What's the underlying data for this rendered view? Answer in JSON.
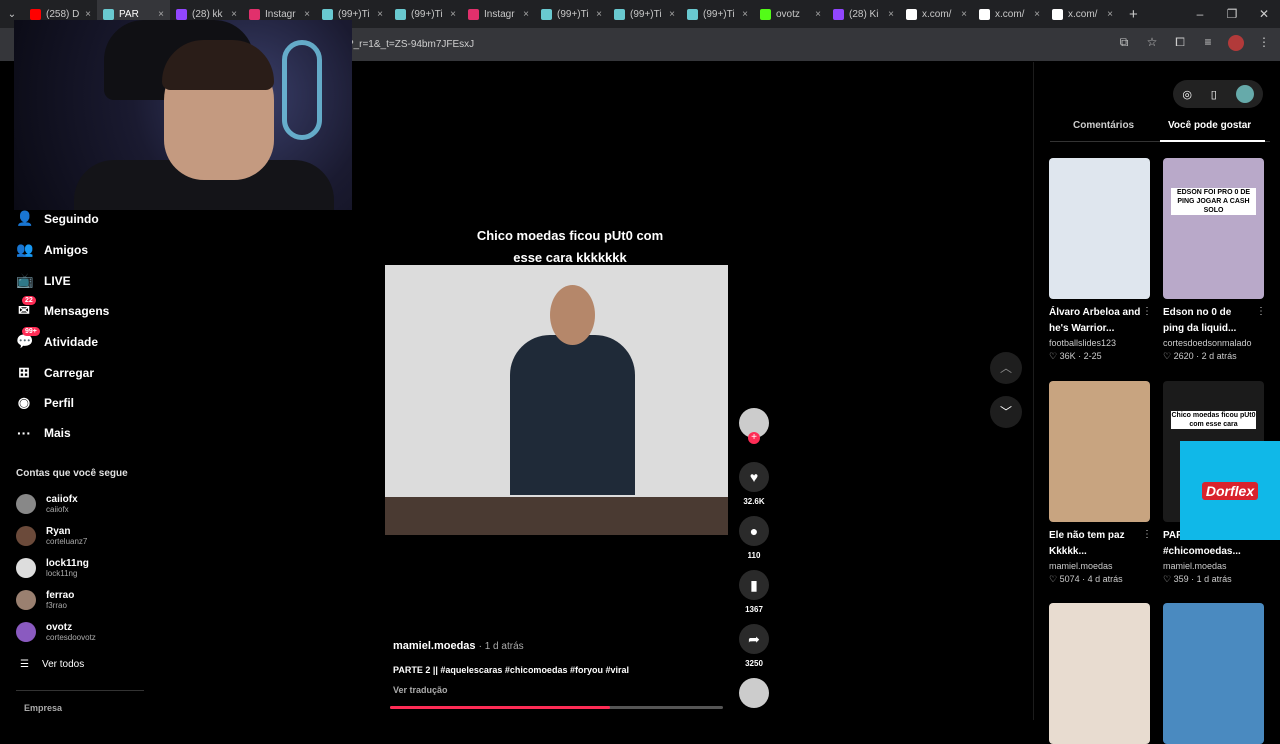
{
  "browser": {
    "tabs": [
      {
        "title": "(258) D",
        "color": "#ff0000"
      },
      {
        "title": "PAR",
        "color": "#69c9d0",
        "active": true
      },
      {
        "title": "(28) kk",
        "color": "#9146ff"
      },
      {
        "title": "Instagr",
        "color": "#e1306c"
      },
      {
        "title": "(99+)Ti",
        "color": "#69c9d0"
      },
      {
        "title": "(99+)Ti",
        "color": "#69c9d0"
      },
      {
        "title": "Instagr",
        "color": "#e1306c"
      },
      {
        "title": "(99+)Ti",
        "color": "#69c9d0"
      },
      {
        "title": "(99+)Ti",
        "color": "#69c9d0"
      },
      {
        "title": "(99+)Ti",
        "color": "#69c9d0"
      },
      {
        "title": "ovotz",
        "color": "#53fc18"
      },
      {
        "title": "(28) Ki",
        "color": "#9146ff"
      },
      {
        "title": "x.com/",
        "color": "#ffffff"
      },
      {
        "title": "x.com/",
        "color": "#ffffff"
      },
      {
        "title": "x.com/",
        "color": "#ffffff"
      }
    ],
    "tab_close": "×",
    "new_tab": "+",
    "url": "?_r=1&_t=ZS-94bm7JFEsxJ",
    "window": {
      "minimize": "–",
      "maximize": "❐",
      "close": "✕"
    }
  },
  "sidebar": {
    "items": [
      {
        "label": "Seguindo",
        "icon": "👤"
      },
      {
        "label": "Amigos",
        "icon": "👥"
      },
      {
        "label": "LIVE",
        "icon": "📺"
      },
      {
        "label": "Mensagens",
        "icon": "✉",
        "badge": "22"
      },
      {
        "label": "Atividade",
        "icon": "💬",
        "badge": "99+"
      },
      {
        "label": "Carregar",
        "icon": "⊞"
      },
      {
        "label": "Perfil",
        "icon": "◉"
      },
      {
        "label": "Mais",
        "icon": "···"
      }
    ],
    "following_header": "Contas que você segue",
    "accounts": [
      {
        "name": "caiiofx",
        "handle": "caiiofx",
        "color": "#888"
      },
      {
        "name": "Ryan",
        "handle": "corteluanz7",
        "color": "#6b4a3a"
      },
      {
        "name": "lock11ng",
        "handle": "lock11ng",
        "color": "#ddd"
      },
      {
        "name": "ferrao",
        "handle": "f3rrao",
        "color": "#9a8070"
      },
      {
        "name": "ovotz",
        "handle": "cortesdoovotz",
        "color": "#8a5ac0"
      }
    ],
    "see_all": "Ver todos",
    "see_all_icon": "☰",
    "company": "Empresa"
  },
  "video": {
    "caption_line1": "Chico moedas ficou pUt0 com",
    "caption_line2": "esse cara kkkkkkk",
    "author": "mamiel.moedas",
    "posted": "· 1 d atrás",
    "description": "PARTE 2 || #aquelescaras #chicomoedas #foryou #viral",
    "translate": "Ver tradução",
    "progress": 0.66
  },
  "actions": {
    "likes": "32.6K",
    "comments": "110",
    "saves": "1367",
    "shares": "3250",
    "follow_plus": "+"
  },
  "nav_buttons": {
    "up": "︿",
    "down": "﹀"
  },
  "right_panel": {
    "tabs": {
      "comments": "Comentários",
      "suggested": "Você pode gostar"
    },
    "cards": [
      {
        "title": "Álvaro Arbeloa and he's Warrior...",
        "user": "footballslides123",
        "stats": "♡ 36K · 2-25",
        "bg": "#dfe6ee"
      },
      {
        "title": "Edson no 0 de ping da liquid...",
        "user": "cortesdoedsonmalado",
        "stats": "♡ 2620 · 2 d atrás",
        "bg": "#b9a9c9",
        "overlay": "EDSON FOI PRO 0 DE PING JOGAR A CASH SOLO"
      },
      {
        "title": "Ele não tem paz Kkkkk...",
        "user": "mamiel.moedas",
        "stats": "♡ 5074 · 4 d atrás",
        "bg": "#c8a480"
      },
      {
        "title": "PARTE 1 #chicomoedas...",
        "user": "mamiel.moedas",
        "stats": "♡ 359 · 1 d atrás",
        "bg": "#1b1b1b",
        "overlay": "Chico moedas ficou pUt0 com esse cara"
      },
      {
        "title": "",
        "user": "",
        "stats": "",
        "bg": "#e8dcd0"
      },
      {
        "title": "",
        "user": "",
        "stats": "",
        "bg": "#4a8ac0"
      }
    ],
    "more_icon": "⋮"
  },
  "ad": {
    "brand": "Dorflex"
  }
}
